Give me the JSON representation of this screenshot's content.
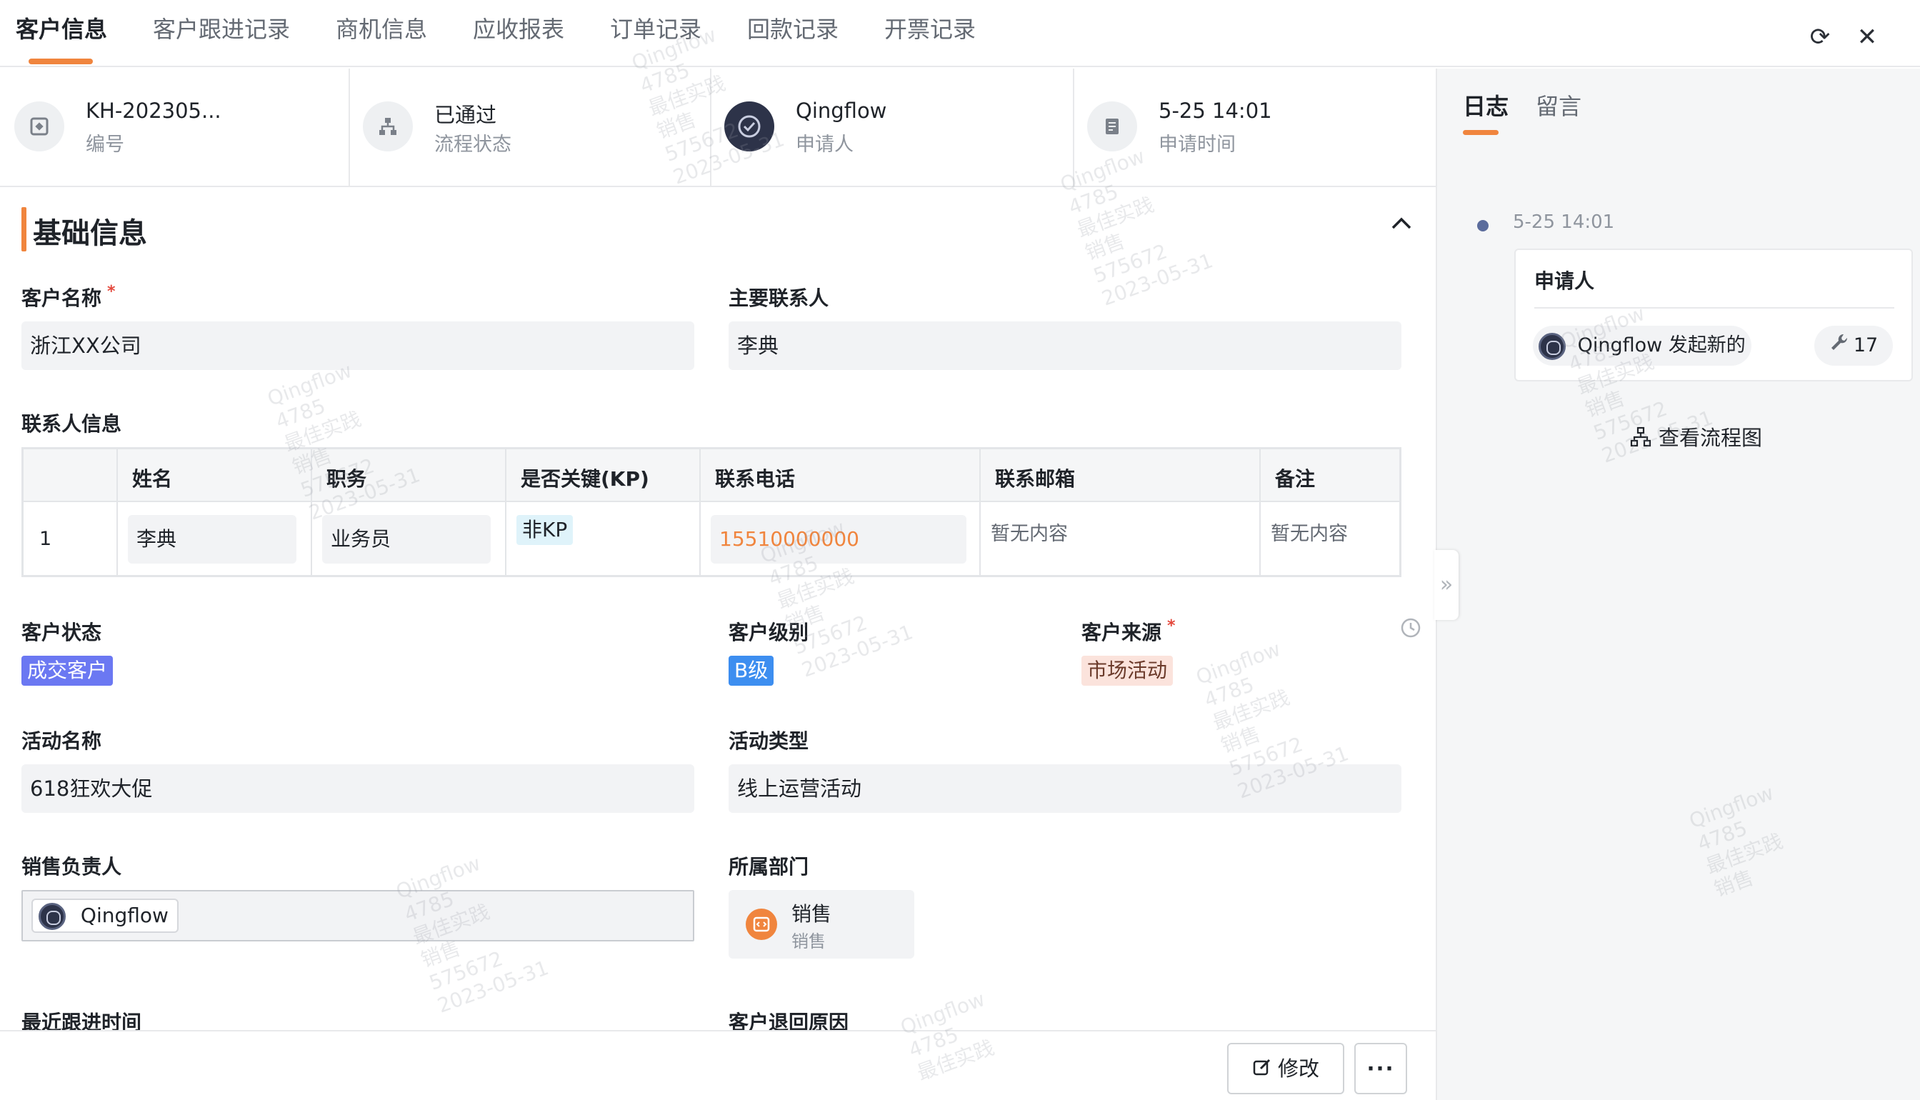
{
  "tabs": [
    {
      "label": "客户信息"
    },
    {
      "label": "客户跟进记录"
    },
    {
      "label": "商机信息"
    },
    {
      "label": "应收报表"
    },
    {
      "label": "订单记录"
    },
    {
      "label": "回款记录"
    },
    {
      "label": "开票记录"
    }
  ],
  "summary": [
    {
      "main": "KH-202305...",
      "sub": "编号",
      "icon": "tag-icon"
    },
    {
      "main": "已通过",
      "sub": "流程状态",
      "icon": "flow-icon"
    },
    {
      "main": "Qingflow",
      "sub": "申请人",
      "icon": "avatar-icon"
    },
    {
      "main": "5-25 14:01",
      "sub": "申请时间",
      "icon": "clock-doc-icon"
    }
  ],
  "section": {
    "title": "基础信息"
  },
  "fields": {
    "customer_name": {
      "label": "客户名称",
      "value": "浙江XX公司",
      "required": "*"
    },
    "main_contact": {
      "label": "主要联系人",
      "value": "李典"
    },
    "contact_info": {
      "label": "联系人信息"
    },
    "customer_status": {
      "label": "客户状态",
      "value": "成交客户"
    },
    "customer_level": {
      "label": "客户级别",
      "value": "B级"
    },
    "customer_source": {
      "label": "客户来源",
      "value": "市场活动",
      "required": "*"
    },
    "activity_name": {
      "label": "活动名称",
      "value": "618狂欢大促"
    },
    "activity_type": {
      "label": "活动类型",
      "value": "线上运营活动"
    },
    "sales_owner": {
      "label": "销售负责人",
      "value": "Qingflow"
    },
    "department": {
      "label": "所属部门",
      "value": "销售",
      "sub": "销售"
    },
    "last_follow": {
      "label": "最近跟进时间"
    },
    "return_reason": {
      "label": "客户退回原因"
    }
  },
  "contact_table": {
    "headers": [
      "姓名",
      "职务",
      "是否关键(KP)",
      "联系电话",
      "联系邮箱",
      "备注"
    ],
    "rows": [
      {
        "index": "1",
        "name": "李典",
        "title": "业务员",
        "kp": "非KP",
        "phone": "15510000000",
        "email": "暂无内容",
        "note": "暂无内容"
      }
    ]
  },
  "actions": {
    "edit": "修改",
    "more": "···"
  },
  "right_panel": {
    "tabs": [
      {
        "label": "日志"
      },
      {
        "label": "留言"
      }
    ],
    "log": {
      "time": "5-25 14:01",
      "card_title": "申请人",
      "actor": "Qingflow 发起新的",
      "count": "17"
    },
    "view_flow": "查看流程图"
  },
  "watermark": {
    "line1": "Qingflow",
    "line2": "4785",
    "line3": "最佳实践",
    "line4": "销售",
    "line5": "575672",
    "line6": "2023-05-31"
  },
  "colors": {
    "accent": "#f0853e",
    "status_tag": "#6b78f2",
    "level_tag": "#3d8ef0",
    "source_tag_bg": "#fbe3dc",
    "phone": "#f0853e"
  }
}
